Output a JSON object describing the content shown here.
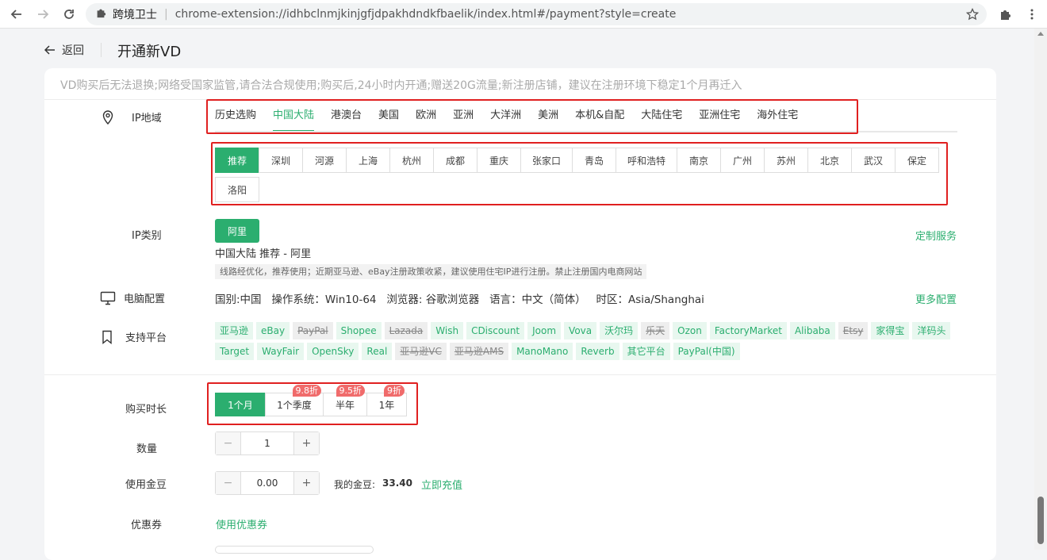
{
  "browser": {
    "extension_name": "跨境卫士",
    "url": "chrome-extension://idhbclnmjkinjgfjdpakhdndkfbaelik/index.html#/payment?style=create"
  },
  "header": {
    "back_label": "返回",
    "title": "开通新VD"
  },
  "notice": "VD购买后无法退换;网络受国家监管,请合法合规使用;购买后,24小时内开通;赠送20G流量;新注册店铺，建议在注册环境下稳定1个月再迁入",
  "ip_region": {
    "label": "IP地域",
    "tabs": [
      "历史选购",
      "中国大陆",
      "港澳台",
      "美国",
      "欧洲",
      "亚洲",
      "大洋洲",
      "美洲",
      "本机&自配",
      "大陆住宅",
      "亚洲住宅",
      "海外住宅"
    ],
    "active_tab": "中国大陆",
    "cities": [
      "推荐",
      "深圳",
      "河源",
      "上海",
      "杭州",
      "成都",
      "重庆",
      "张家口",
      "青岛",
      "呼和浩特",
      "南京",
      "广州",
      "苏州",
      "北京",
      "武汉",
      "保定",
      "洛阳"
    ],
    "active_city": "推荐"
  },
  "ip_type": {
    "label": "IP类别",
    "option": "阿里",
    "custom_link": "定制服务",
    "summary": "中国大陆 推荐 - 阿里",
    "hint": "线路经优化，推荐使用；近期亚马逊、eBay注册政策收紧，建议使用住宅IP进行注册。禁止注册国内电商网站"
  },
  "pc_config": {
    "label": "电脑配置",
    "value": "国别:中国   操作系统：Win10-64   浏览器: 谷歌浏览器   语言：中文（简体）   时区：Asia/Shanghai",
    "more_link": "更多配置"
  },
  "platforms": {
    "label": "支持平台",
    "items": [
      {
        "name": "亚马逊",
        "on": true
      },
      {
        "name": "eBay",
        "on": true
      },
      {
        "name": "PayPal",
        "on": false
      },
      {
        "name": "Shopee",
        "on": true
      },
      {
        "name": "Lazada",
        "on": false
      },
      {
        "name": "Wish",
        "on": true
      },
      {
        "name": "CDiscount",
        "on": true
      },
      {
        "name": "Joom",
        "on": true
      },
      {
        "name": "Vova",
        "on": true
      },
      {
        "name": "沃尔玛",
        "on": true
      },
      {
        "name": "乐天",
        "on": false
      },
      {
        "name": "Ozon",
        "on": true
      },
      {
        "name": "FactoryMarket",
        "on": true
      },
      {
        "name": "Alibaba",
        "on": true
      },
      {
        "name": "Etsy",
        "on": false
      },
      {
        "name": "家得宝",
        "on": true
      },
      {
        "name": "洋码头",
        "on": true
      },
      {
        "name": "Target",
        "on": true
      },
      {
        "name": "WayFair",
        "on": true
      },
      {
        "name": "OpenSky",
        "on": true
      },
      {
        "name": "Real",
        "on": true
      },
      {
        "name": "亚马逊VC",
        "on": false
      },
      {
        "name": "亚马逊AMS",
        "on": false
      },
      {
        "name": "ManoMano",
        "on": true
      },
      {
        "name": "Reverb",
        "on": true
      },
      {
        "name": "其它平台",
        "on": true
      },
      {
        "name": "PayPal(中国)",
        "on": true
      }
    ]
  },
  "duration": {
    "label": "购买时长",
    "options": [
      {
        "label": "1个月",
        "badge": "",
        "active": true
      },
      {
        "label": "1个季度",
        "badge": "9.8折",
        "active": false
      },
      {
        "label": "半年",
        "badge": "9.5折",
        "active": false
      },
      {
        "label": "1年",
        "badge": "9折",
        "active": false
      }
    ]
  },
  "quantity": {
    "label": "数量",
    "value": "1",
    "minus": "−",
    "plus": "+"
  },
  "gold": {
    "label": "使用金豆",
    "value": "0.00",
    "mine_label": "我的金豆:",
    "mine_value": "33.40",
    "recharge_link": "立即充值"
  },
  "coupon": {
    "label": "优惠券",
    "link": "使用优惠券"
  }
}
